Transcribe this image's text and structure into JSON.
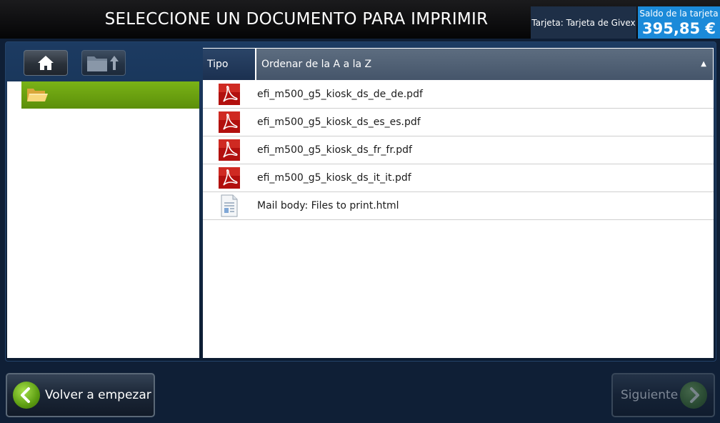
{
  "header": {
    "title": "SELECCIONE UN DOCUMENTO PARA IMPRIMIR",
    "card_label": "Tarjeta: Tarjeta de Givex",
    "balance_label": "Saldo de la tarjeta",
    "balance_amount": "395,85 €"
  },
  "toolbar": {
    "home_icon": "home-icon",
    "folder_up_icon": "folder-up-icon"
  },
  "tree": {
    "selected_icon": "open-folder-icon"
  },
  "file_list": {
    "col_type": "Tipo",
    "col_name": "Ordenar de la A a la Z",
    "sort_indicator": "▲",
    "files": [
      {
        "name": "efi_m500_g5_kiosk_ds_de_de.pdf",
        "icon": "pdf-icon"
      },
      {
        "name": "efi_m500_g5_kiosk_ds_es_es.pdf",
        "icon": "pdf-icon"
      },
      {
        "name": "efi_m500_g5_kiosk_ds_fr_fr.pdf",
        "icon": "pdf-icon"
      },
      {
        "name": "efi_m500_g5_kiosk_ds_it_it.pdf",
        "icon": "pdf-icon"
      },
      {
        "name": "Mail body: Files to print.html",
        "icon": "html-document-icon"
      }
    ]
  },
  "footer": {
    "back_label": "Volver a empezar",
    "next_label": "Siguiente"
  },
  "colors": {
    "accent_green": "#6fa713",
    "balance_blue": "#1b8ad9",
    "header_bg": "#111113"
  }
}
